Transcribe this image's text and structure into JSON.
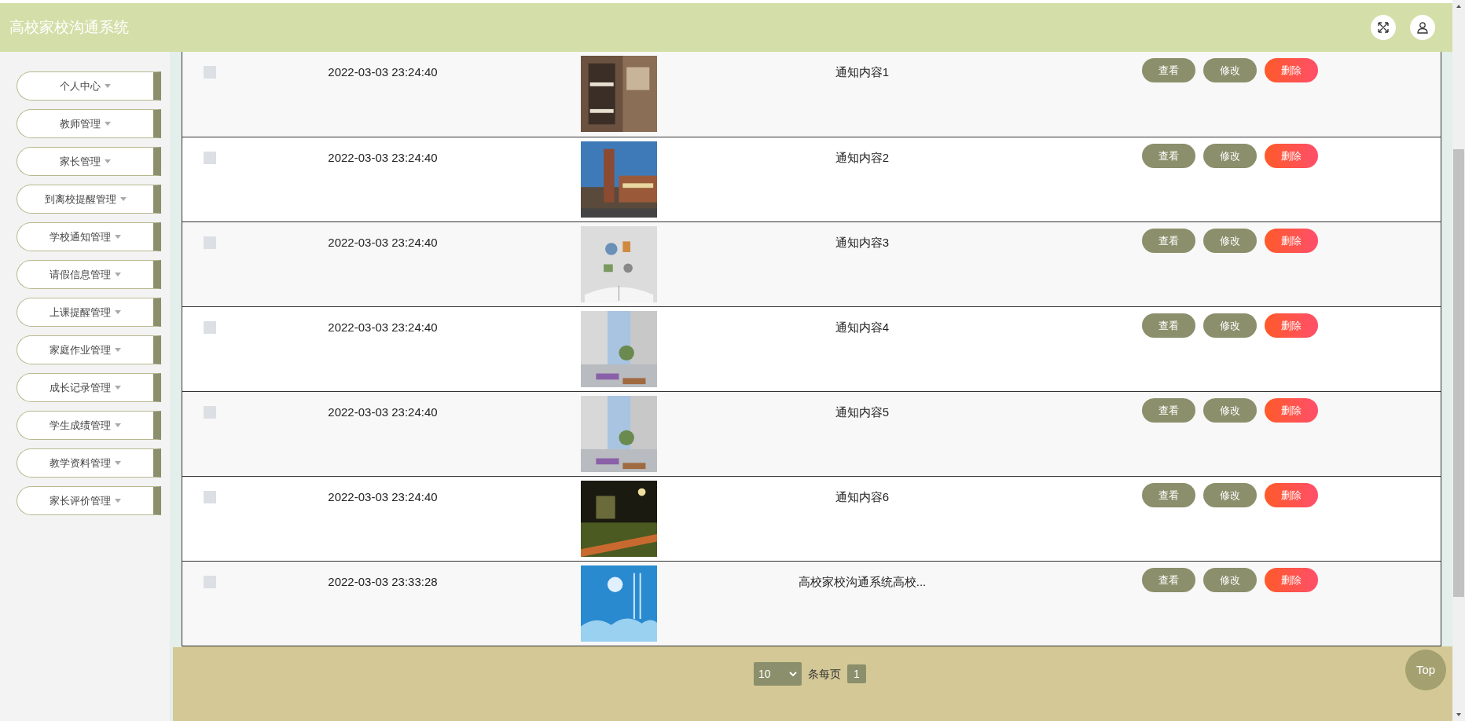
{
  "header": {
    "title": "高校家校沟通系统"
  },
  "sidebar": {
    "items": [
      {
        "label": "个人中心"
      },
      {
        "label": "教师管理"
      },
      {
        "label": "家长管理"
      },
      {
        "label": "到离校提醒管理"
      },
      {
        "label": "学校通知管理"
      },
      {
        "label": "请假信息管理"
      },
      {
        "label": "上课提醒管理"
      },
      {
        "label": "家庭作业管理"
      },
      {
        "label": "成长记录管理"
      },
      {
        "label": "学生成绩管理"
      },
      {
        "label": "教学资料管理"
      },
      {
        "label": "家长评价管理"
      }
    ]
  },
  "table": {
    "rows": [
      {
        "checked": false,
        "time": "2022-03-03 23:24:40",
        "content": "通知内容1",
        "actions": [
          "查看",
          "修改",
          "删除"
        ]
      },
      {
        "checked": false,
        "time": "2022-03-03 23:24:40",
        "content": "通知内容2",
        "actions": [
          "查看",
          "修改",
          "删除"
        ]
      },
      {
        "checked": false,
        "time": "2022-03-03 23:24:40",
        "content": "通知内容3",
        "actions": [
          "查看",
          "修改",
          "删除"
        ]
      },
      {
        "checked": false,
        "time": "2022-03-03 23:24:40",
        "content": "通知内容4",
        "actions": [
          "查看",
          "修改",
          "删除"
        ]
      },
      {
        "checked": false,
        "time": "2022-03-03 23:24:40",
        "content": "通知内容5",
        "actions": [
          "查看",
          "修改",
          "删除"
        ]
      },
      {
        "checked": false,
        "time": "2022-03-03 23:24:40",
        "content": "通知内容6",
        "actions": [
          "查看",
          "修改",
          "删除"
        ]
      },
      {
        "checked": false,
        "time": "2022-03-03 23:33:28",
        "content": "高校家校沟通系统高校...",
        "actions": [
          "查看",
          "修改",
          "删除"
        ]
      }
    ]
  },
  "pagination": {
    "page_size": "10",
    "per_page_label": "条每页",
    "pages": [
      {
        "label": "1",
        "selected": true
      }
    ]
  },
  "back_to_top": "Top"
}
